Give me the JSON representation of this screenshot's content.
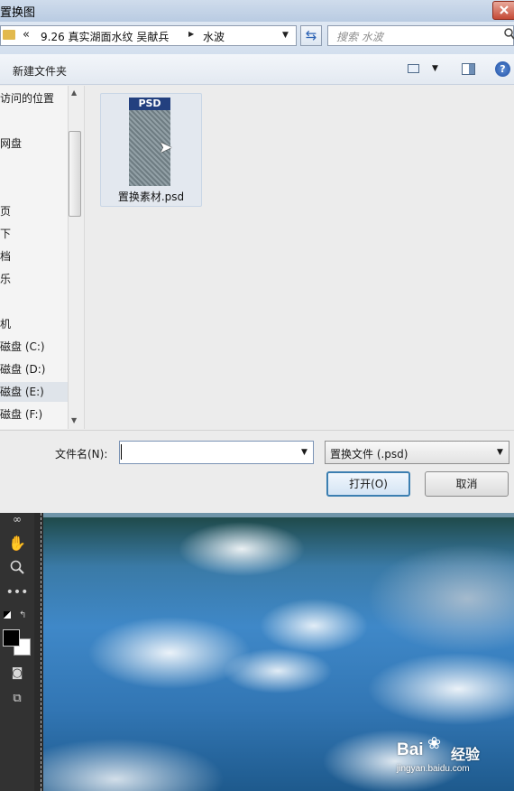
{
  "dialog": {
    "title": "置换图",
    "close_icon": "close-icon"
  },
  "address": {
    "chevron": "«",
    "crumbs": [
      "9.26 真实湖面水纹 吴献兵",
      "水波"
    ],
    "search_placeholder": "搜索 水波"
  },
  "toolbar": {
    "new_folder": "新建文件夹",
    "help": "?"
  },
  "nav": {
    "items": [
      "访问的位置",
      "网盘",
      "",
      "页",
      "下",
      "档",
      "乐",
      "",
      "机",
      "磁盘 (C:)",
      "磁盘 (D:)",
      "磁盘 (E:)",
      "磁盘 (F:)"
    ]
  },
  "files": {
    "items": [
      {
        "name": "置换素材.psd",
        "badge": "PSD"
      }
    ]
  },
  "bottom": {
    "filename_label": "文件名(N):",
    "filename_value": "",
    "filetype_value": "置换文件 (.psd)",
    "open_label": "打开(O)",
    "cancel_label": "取消"
  },
  "watermark": {
    "logo_text": "Bai",
    "logo_suffix": "经验",
    "url": "jingyan.baidu.com"
  },
  "colors": {
    "dialog_bg": "#ececec",
    "accent_button_border": "#3c7fb1",
    "ps_panel": "#323232"
  }
}
